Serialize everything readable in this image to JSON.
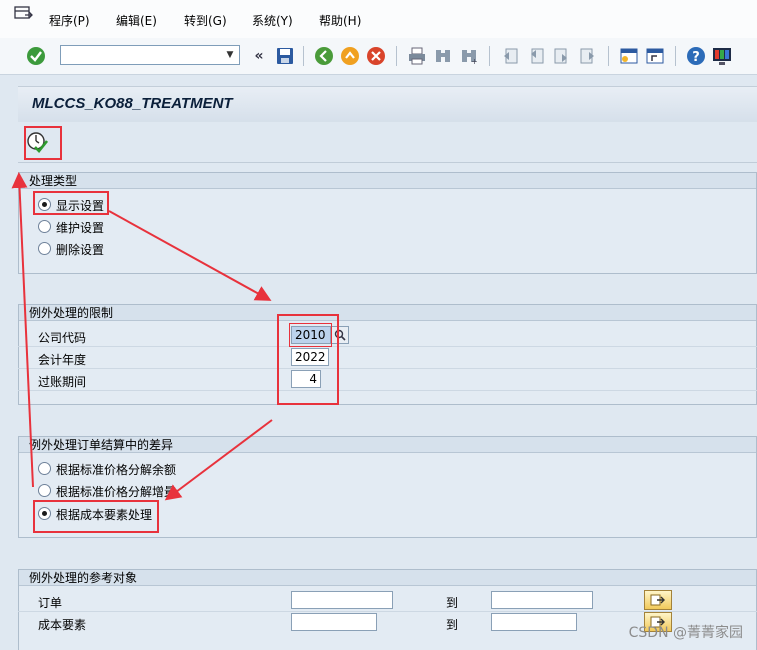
{
  "menu": {
    "items": [
      "程序(P)",
      "编辑(E)",
      "转到(G)",
      "系统(Y)",
      "帮助(H)"
    ]
  },
  "toolbar": {
    "command_value": "",
    "icons": [
      "enter-icon",
      "command-field",
      "back-double-icon",
      "save-icon",
      "back-icon",
      "exit-icon",
      "cancel-icon",
      "print-icon",
      "find-icon",
      "find-next-icon",
      "first-page-icon",
      "previous-page-icon",
      "next-page-icon",
      "last-page-icon",
      "new-session-icon",
      "shortcut-icon",
      "help-icon",
      "customize-layout-icon"
    ]
  },
  "title": "MLCCS_KO88_TREATMENT",
  "group_processing_type": {
    "title": "处理类型",
    "options": [
      "显示设置",
      "维护设置",
      "删除设置"
    ],
    "selected": 0
  },
  "group_restrictions": {
    "title": "例外处理的限制",
    "company_code_label": "公司代码",
    "company_code_value": "2010",
    "fiscal_year_label": "会计年度",
    "fiscal_year_value": "2022",
    "period_label": "过账期间",
    "period_value": "4"
  },
  "group_variance": {
    "title": "例外处理订单结算中的差异",
    "options": [
      "根据标准价格分解余额",
      "根据标准价格分解增量",
      "根据成本要素处理"
    ],
    "selected": 2
  },
  "group_reference": {
    "title": "例外处理的参考对象",
    "order_label": "订单",
    "cost_element_label": "成本要素",
    "to_label": "到",
    "order_from": "",
    "order_to": "",
    "cost_from": "",
    "cost_to": ""
  },
  "watermark": "CSDN @菁菁家园"
}
